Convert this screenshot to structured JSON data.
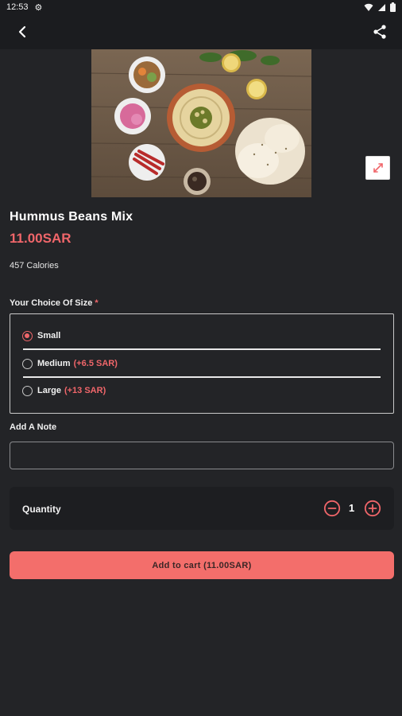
{
  "status_bar": {
    "time": "12:53"
  },
  "product": {
    "name": "Hummus Beans Mix",
    "price": "11.00SAR",
    "calories": "457 Calories"
  },
  "size_section": {
    "label": "Your Choice Of Size",
    "required_mark": "*",
    "options": [
      {
        "label": "Small",
        "extra": "",
        "selected": true
      },
      {
        "label": "Medium",
        "extra": "(+6.5 SAR)",
        "selected": false
      },
      {
        "label": "Large",
        "extra": "(+13 SAR)",
        "selected": false
      }
    ]
  },
  "note": {
    "label": "Add A Note",
    "value": "",
    "placeholder": ""
  },
  "quantity": {
    "label": "Quantity",
    "value": "1"
  },
  "cart_button": {
    "label": "Add to cart (11.00SAR)"
  },
  "icons": {
    "back": "arrow-back-icon",
    "share": "share-icon",
    "expand": "expand-icon",
    "minus": "minus-circle-icon",
    "plus": "plus-circle-icon"
  },
  "colors": {
    "accent": "#f0666a",
    "background": "#232427",
    "button": "#f36e6b"
  }
}
